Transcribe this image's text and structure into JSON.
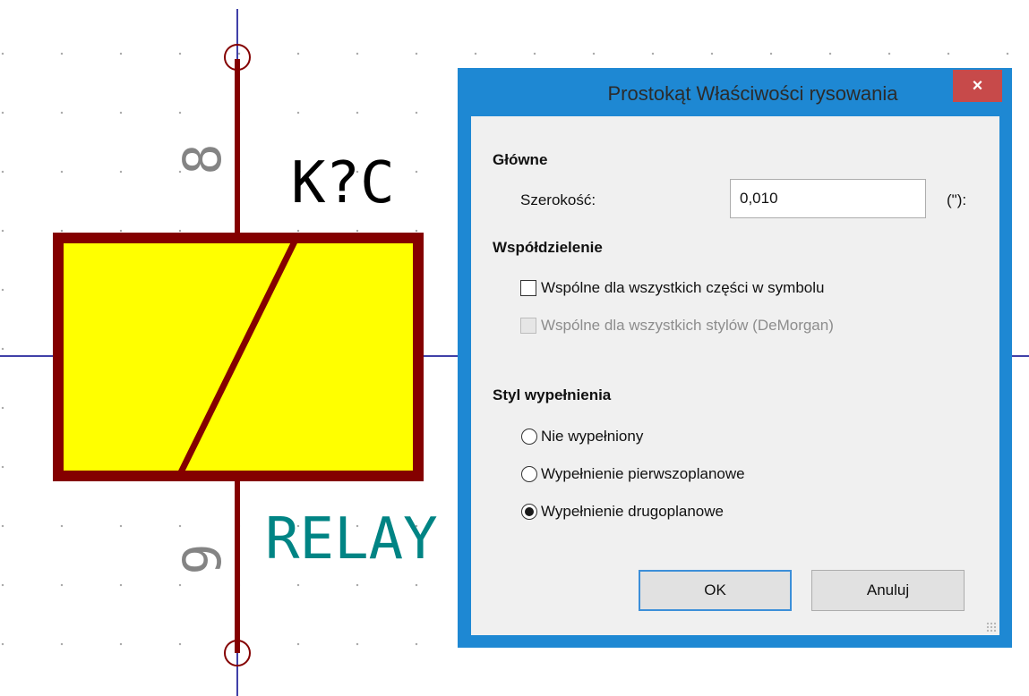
{
  "schematic": {
    "reference": "K?C",
    "value": "RELAY",
    "pin_top_number": "8",
    "pin_bottom_number": "9",
    "colors": {
      "body_outline": "#840000",
      "body_fill": "#ffff00",
      "wire": "#840000",
      "axis": "#00008b",
      "reference_text": "#000000",
      "value_text": "#008484",
      "pin_number": "#848484"
    }
  },
  "dialog": {
    "title": "Prostokąt Właściwości rysowania",
    "close_label": "×",
    "main_section": "Główne",
    "width_label": "Szerokość:",
    "width_value": "0,010",
    "width_unit": "(\"):",
    "sharing_section": "Współdzielenie",
    "share_parts_label": "Wspólne dla wszystkich części w symbolu",
    "share_parts_checked": false,
    "share_styles_label": "Wspólne dla wszystkich stylów (DeMorgan)",
    "share_styles_checked": false,
    "share_styles_enabled": false,
    "fill_section": "Styl wypełnienia",
    "fill_options": [
      {
        "label": "Nie wypełniony",
        "selected": false
      },
      {
        "label": "Wypełnienie pierwszoplanowe",
        "selected": false
      },
      {
        "label": "Wypełnienie drugoplanowe",
        "selected": true
      }
    ],
    "ok_label": "OK",
    "cancel_label": "Anuluj",
    "colors": {
      "frame": "#1e88d3",
      "close_button": "#c74a4a",
      "client_bg": "#f0f0f0"
    }
  }
}
